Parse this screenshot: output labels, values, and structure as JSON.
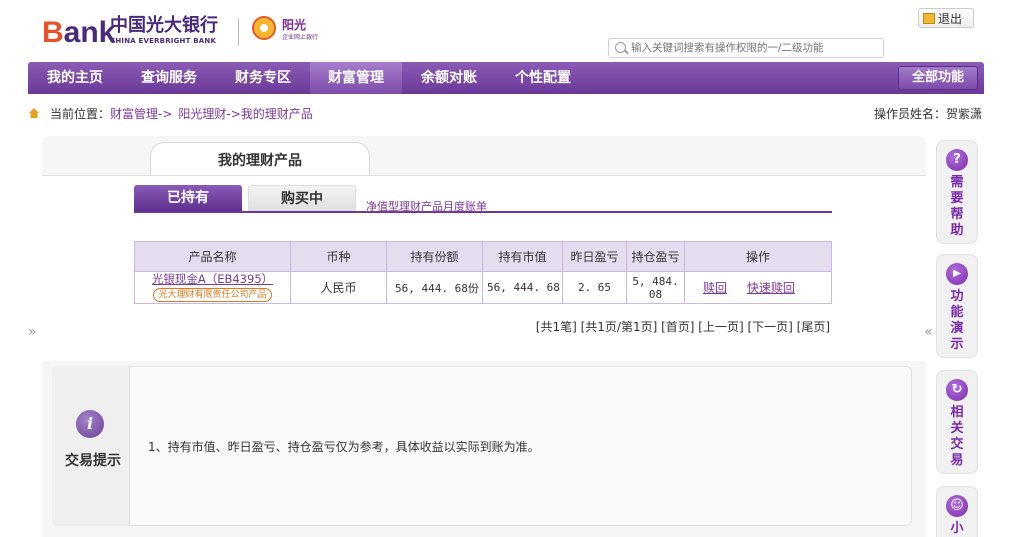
{
  "header": {
    "logo_b": "B",
    "logo_ank": "ank",
    "logo_cn": "中国光大银行",
    "logo_en": "CHINA EVERBRIGHT BANK",
    "sub_cn": "阳光",
    "sub_en": "企业网上银行",
    "search_placeholder": "输入关键词搜索有操作权限的一/二级功能",
    "logout_label": "退出"
  },
  "nav": {
    "items": [
      {
        "label": "我的主页"
      },
      {
        "label": "查询服务"
      },
      {
        "label": "财务专区"
      },
      {
        "label": "财富管理"
      },
      {
        "label": "余额对账"
      },
      {
        "label": "个性配置"
      }
    ],
    "active_index": 3,
    "all_func_label": "全部功能"
  },
  "breadcrumb": {
    "prefix": "当前位置：",
    "part1": "财富管理->",
    "part2": "阳光理财->我的理财产品"
  },
  "operator": "操作员姓名：贺紫潇",
  "main_tab": "我的理财产品",
  "sub_tabs": {
    "held": "已持有",
    "buying": "购买中"
  },
  "monthly_link": "净值型理财产品月度账单",
  "table": {
    "headers": [
      "产品名称",
      "币种",
      "持有份额",
      "持有市值",
      "昨日盈亏",
      "持仓盈亏",
      "操作"
    ],
    "rows": [
      {
        "name": "光银现金A（EB4395）",
        "badge": "光大理财有限责任公司产品",
        "currency": "人民币",
        "shares": "56, 444. 68份",
        "market_value": "56, 444. 68",
        "yesterday_pnl": "2. 65",
        "position_pnl": "5, 484. 08",
        "op1": "赎回",
        "op2": "快速赎回"
      }
    ]
  },
  "pager": "[共1笔] [共1页/第1页] [首页] [上一页] [下一页] [尾页]",
  "collapse_left": "»",
  "collapse_right": "«",
  "tips": {
    "title": "交易提示",
    "icon": "i",
    "text": "1、持有市值、昨日盈亏、持仓盈亏仅为参考，具体收益以实际到账为准。"
  },
  "side_helpers": [
    {
      "icon_name": "help-icon",
      "glyph": "?",
      "label": "需要帮助"
    },
    {
      "icon_name": "play-icon",
      "glyph": "▶",
      "label": "功能演示"
    },
    {
      "icon_name": "refresh-icon",
      "glyph": "↻",
      "label": "相关交易"
    },
    {
      "icon_name": "smile-icon",
      "glyph": "☺",
      "label": "小"
    }
  ]
}
